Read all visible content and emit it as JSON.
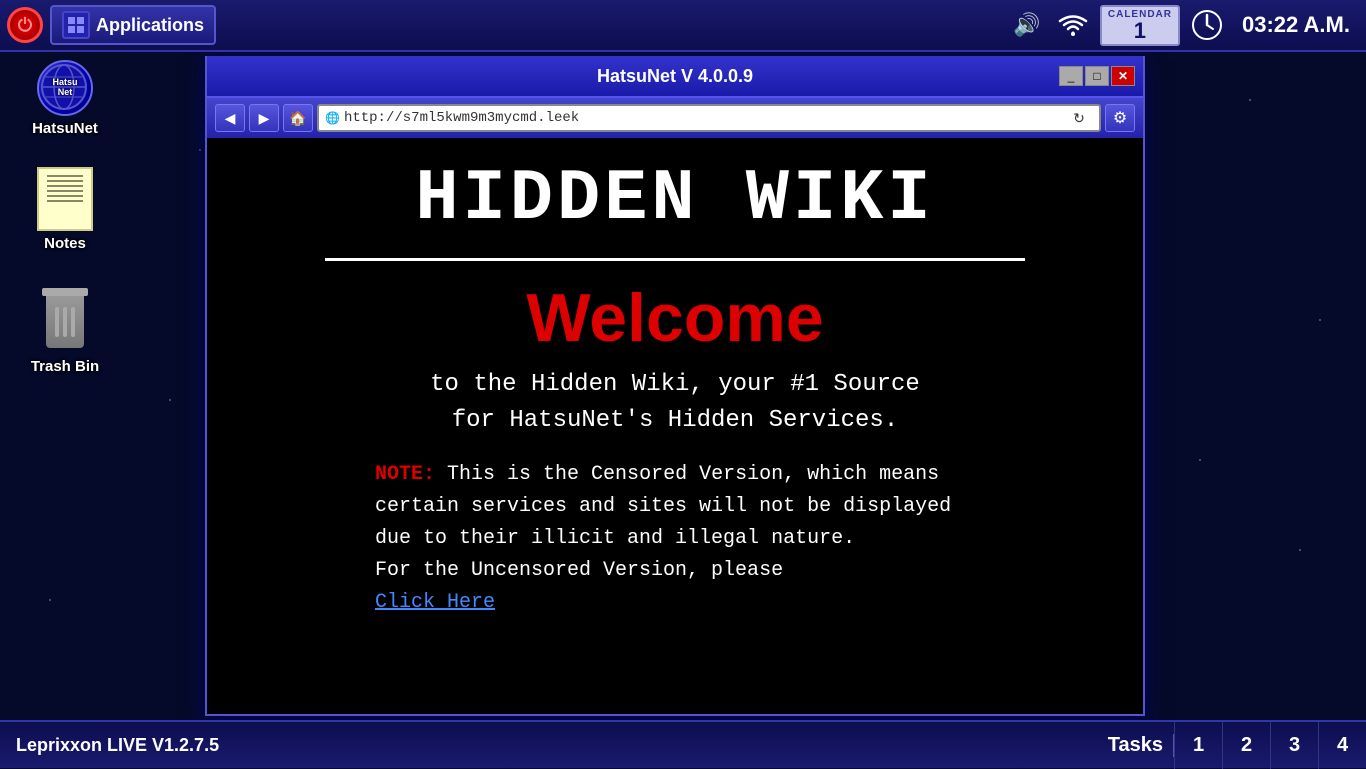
{
  "taskbar": {
    "apps_label": "Applications",
    "time": "03:22 A.M.",
    "calendar": {
      "label": "CALENDAR",
      "day": "1"
    }
  },
  "desktop": {
    "icons": [
      {
        "id": "hatsunet",
        "label": "HatsuNet",
        "inner_label": "Hatsu\nNet"
      },
      {
        "id": "notes",
        "label": "Notes"
      },
      {
        "id": "trash",
        "label": "Trash Bin"
      }
    ]
  },
  "browser": {
    "title": "HatsuNet V 4.0.0.9",
    "url": "http://s7ml5kwm9m3mycmd.leek",
    "controls": {
      "minimize": "_",
      "maximize": "□",
      "close": "✕"
    },
    "content": {
      "heading": "HIDDEN WIKI",
      "welcome": "Welcome",
      "subtitle1": "to the Hidden Wiki, your #1 Source",
      "subtitle2": "for HatsuNet's Hidden Services.",
      "note_label": "NOTE:",
      "note_text": " This is the Censored Version, which means certain services and sites will not be displayed due to their illicit and illegal nature.",
      "note_text2": "For the Uncensored Version, please",
      "click_here": "Click Here"
    }
  },
  "taskbar_bottom": {
    "os_label": "Leprixxon LIVE V1.2.7.5",
    "tasks_label": "Tasks",
    "task_numbers": [
      "1",
      "2",
      "3",
      "4"
    ]
  }
}
